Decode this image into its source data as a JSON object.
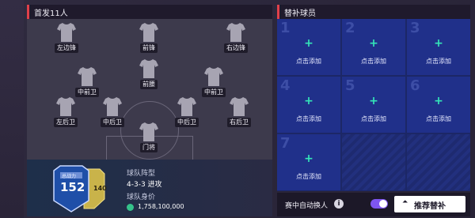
{
  "lineup": {
    "title": "首发11人",
    "players": [
      {
        "label": "左边锋"
      },
      {
        "label": "前锋"
      },
      {
        "label": "右边锋"
      },
      {
        "label": "中前卫"
      },
      {
        "label": "前腰"
      },
      {
        "label": "中前卫"
      },
      {
        "label": "左后卫"
      },
      {
        "label": "中后卫"
      },
      {
        "label": "中后卫"
      },
      {
        "label": "右后卫"
      },
      {
        "label": "门将"
      }
    ]
  },
  "team": {
    "ovr_label": "总战力",
    "ovr_value": "152",
    "sub_value": "140",
    "formation_label": "球队阵型",
    "formation_value": "4-3-3 进攻",
    "value_label": "球队身价",
    "value_amount": "1,758,100,000"
  },
  "subs": {
    "title": "替补球员",
    "slots": [
      {
        "num": "1",
        "text": "点击添加"
      },
      {
        "num": "2",
        "text": "点击添加"
      },
      {
        "num": "3",
        "text": "点击添加"
      },
      {
        "num": "4",
        "text": "点击添加"
      },
      {
        "num": "5",
        "text": "点击添加"
      },
      {
        "num": "6",
        "text": "点击添加"
      },
      {
        "num": "7",
        "text": "点击添加"
      }
    ],
    "plus": "+",
    "auto_sub_label": "赛中自动换人",
    "info_icon": "i",
    "recommend_icon": "⏶",
    "recommend_label": "推荐替补"
  },
  "colors": {
    "accent": "#e0404a",
    "add_icon": "#34e6b8",
    "toggle": "#7e55f0",
    "slot_bg": "#20308a"
  }
}
